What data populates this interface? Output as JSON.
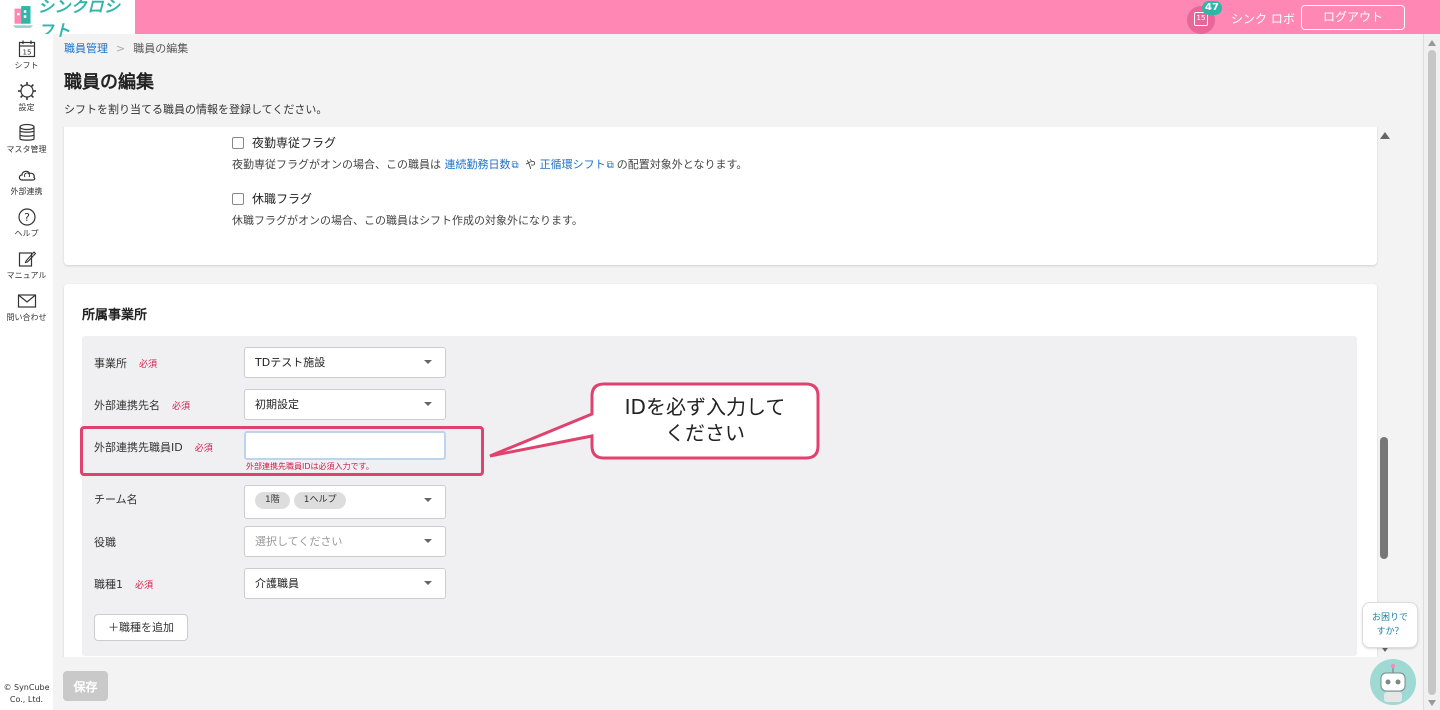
{
  "header": {
    "logo_text": "シンクロシフト",
    "notification_day": "15",
    "notification_count": "47",
    "user_name": "シンク ロボ",
    "logout_label": "ログアウト"
  },
  "sidenav": {
    "items": [
      {
        "label": "シフト",
        "icon": "calendar-icon",
        "day": "15"
      },
      {
        "label": "設定",
        "icon": "gear-icon"
      },
      {
        "label": "マスタ管理",
        "icon": "database-icon"
      },
      {
        "label": "外部連携",
        "icon": "cloud-sync-icon"
      },
      {
        "label": "ヘルプ",
        "icon": "question-icon"
      },
      {
        "label": "マニュアル",
        "icon": "manual-edit-icon"
      },
      {
        "label": "問い合わせ",
        "icon": "mail-icon"
      }
    ],
    "copyright_line1": "© SynCube",
    "copyright_line2": "Co., Ltd."
  },
  "breadcrumb": {
    "parent": "職員管理",
    "separator": ">",
    "current": "職員の編集"
  },
  "page": {
    "title": "職員の編集",
    "description": "シフトを割り当てる職員の情報を登録してください。"
  },
  "flags": {
    "night": {
      "label": "夜勤専従フラグ",
      "note_prefix": "夜勤専従フラグがオンの場合、この職員は",
      "link1": "連続勤務日数",
      "middle": "や",
      "link2": "正循環シフト",
      "note_suffix": "の配置対象外となります。"
    },
    "leave": {
      "label": "休職フラグ",
      "note": "休職フラグがオンの場合、この職員はシフト作成の対象外になります。"
    }
  },
  "office_section": {
    "title": "所属事業所",
    "required_label": "必須",
    "office": {
      "label": "事業所",
      "value": "TDテスト施設"
    },
    "external_partner": {
      "label": "外部連携先名",
      "value": "初期設定"
    },
    "external_staff_id": {
      "label": "外部連携先職員ID",
      "value": "",
      "error": "外部連携先職員IDは必須入力です。"
    },
    "team": {
      "label": "チーム名",
      "chips": [
        "1階",
        "1ヘルプ"
      ]
    },
    "position": {
      "label": "役職",
      "placeholder": "選択してください"
    },
    "job_type": {
      "label": "職種1",
      "value": "介護職員"
    },
    "add_job_label": "＋職種を追加"
  },
  "callout": {
    "line1": "IDを必ず入力して",
    "line2": "ください"
  },
  "footer": {
    "save_label": "保存",
    "help_line1": "お困りで",
    "help_line2": "すか？"
  },
  "colors": {
    "header": "#ff87b4",
    "accent": "#2fb6a8",
    "link": "#1a73c9",
    "required": "#d21a4a",
    "highlight": "#e0426f"
  }
}
